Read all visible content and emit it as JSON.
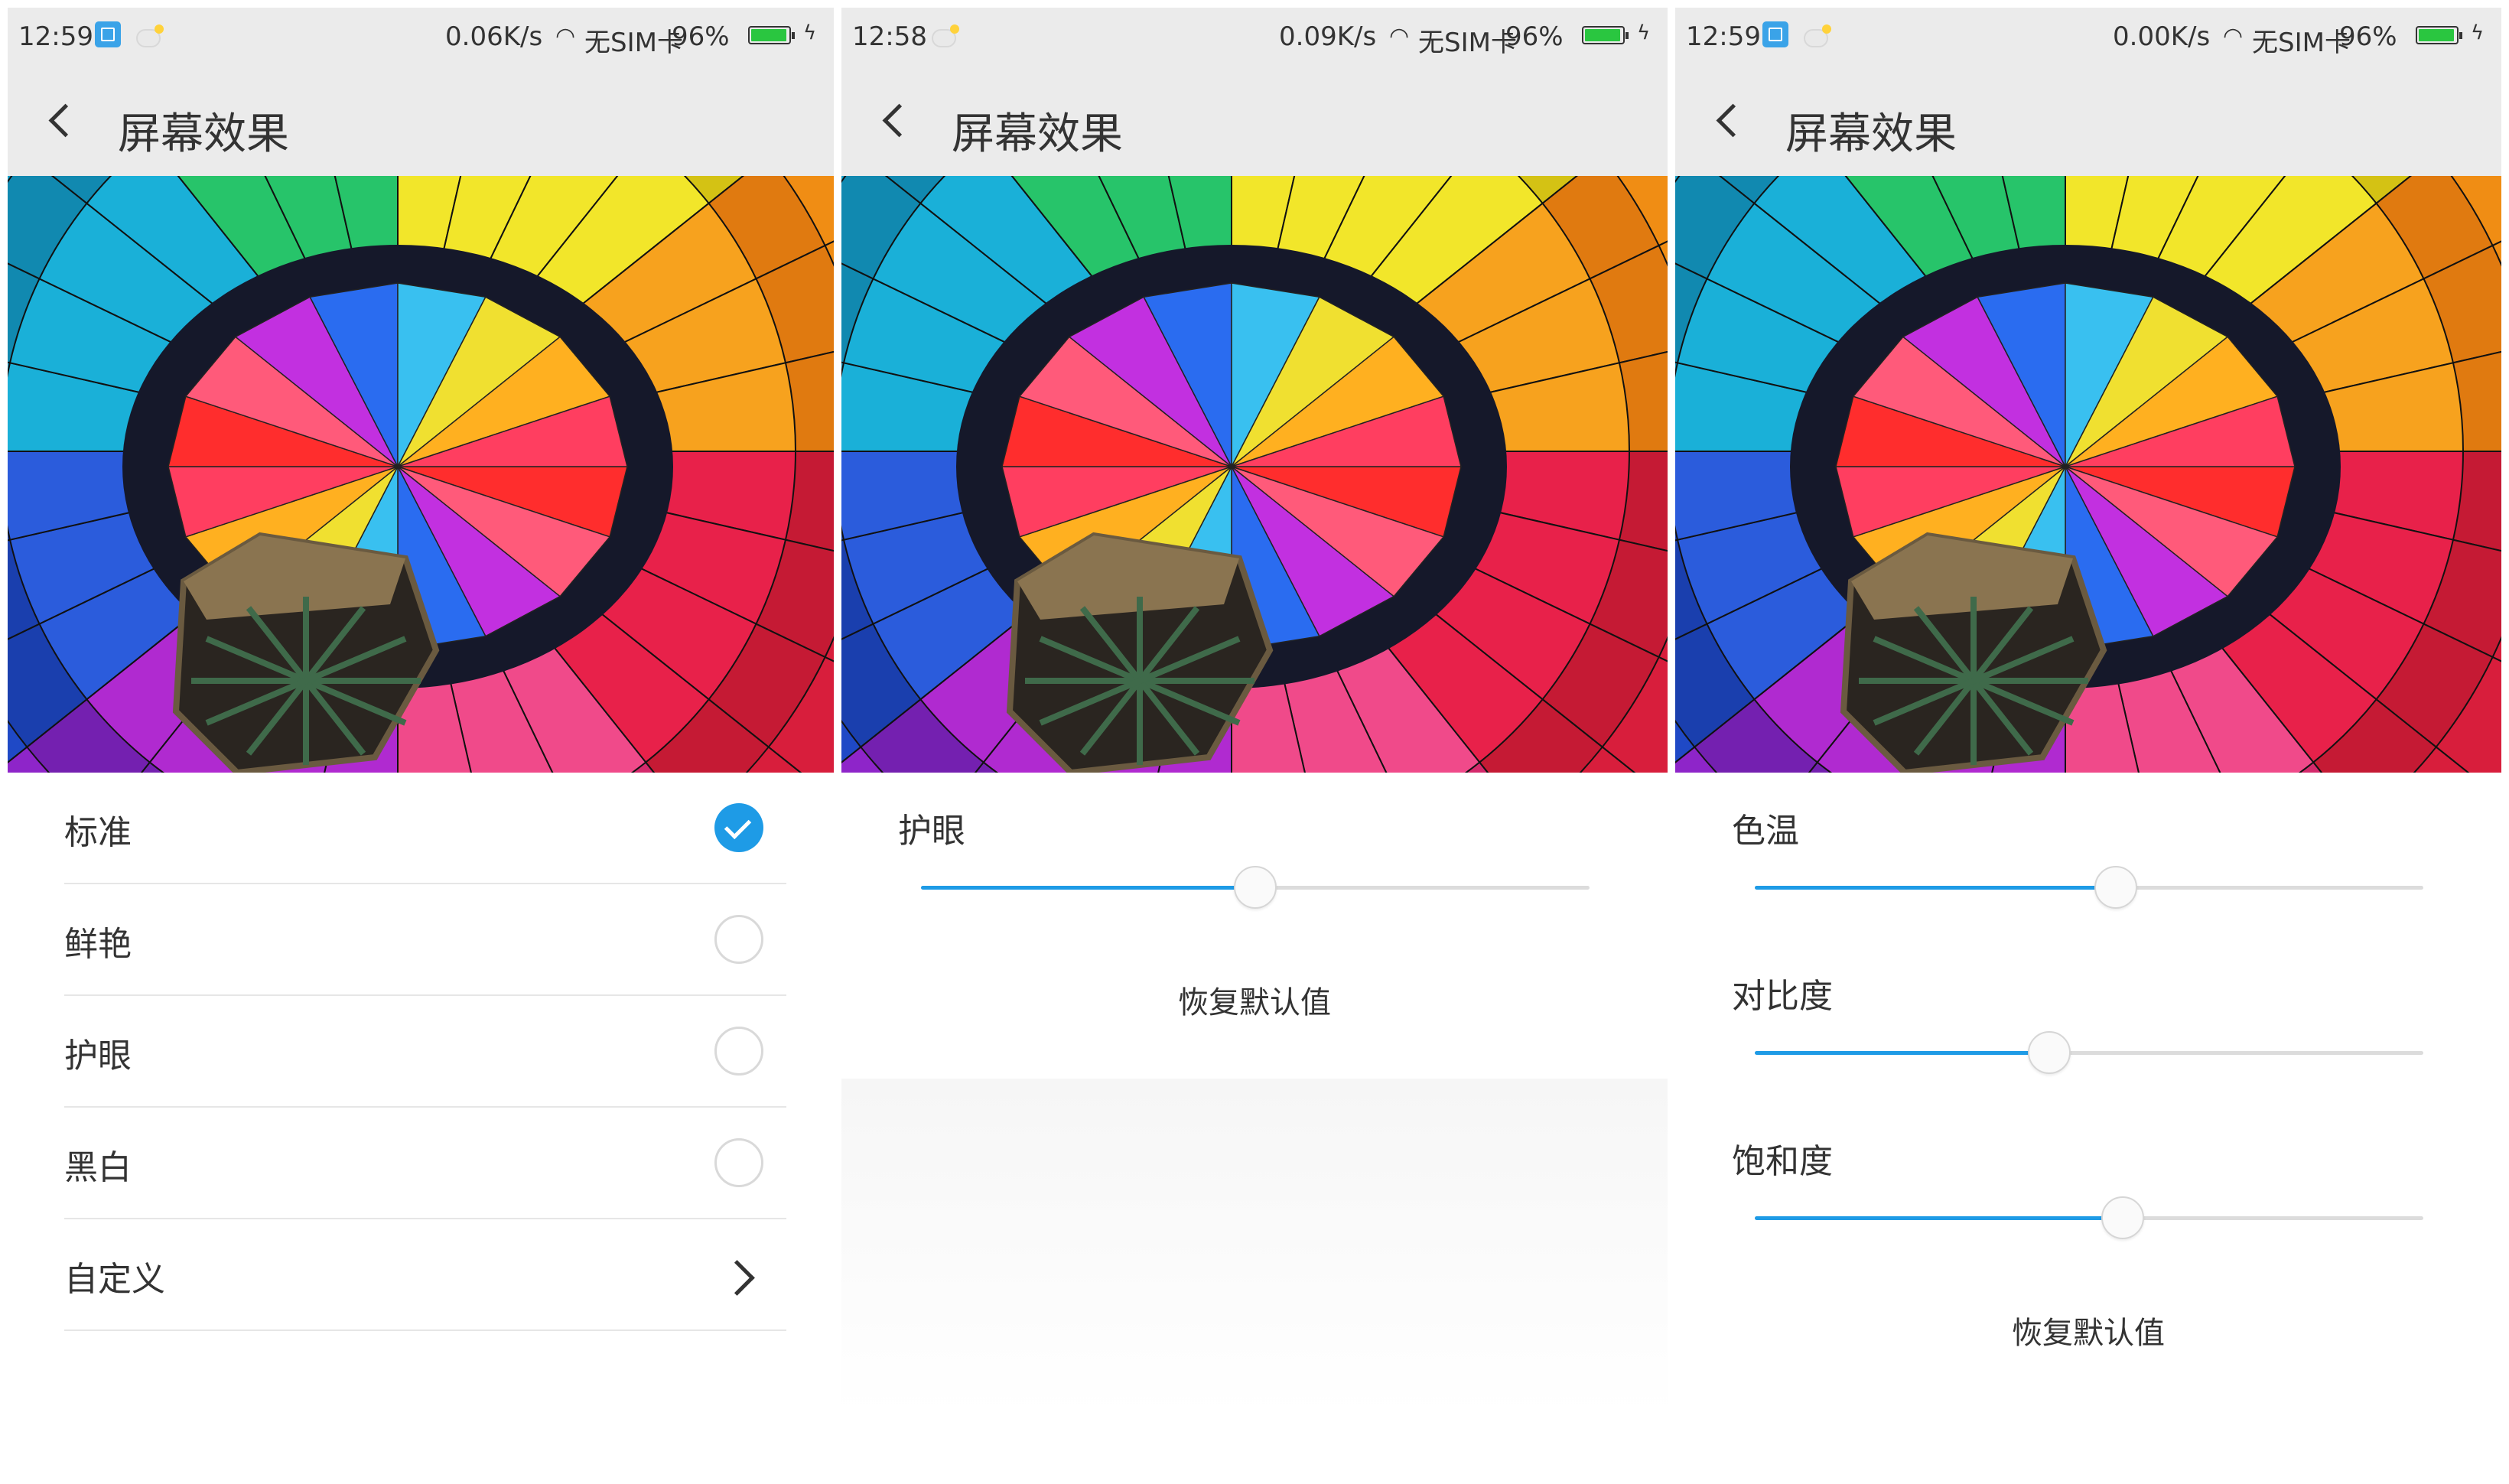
{
  "screens": [
    {
      "status": {
        "time": "12:59",
        "speed": "0.06K/s",
        "sim": "无SIM卡",
        "battery": "96%",
        "battery_level": 0.96,
        "has_screenshot_icon": true
      },
      "header": {
        "title": "屏幕效果"
      },
      "options": [
        {
          "label": "标准",
          "state": "selected"
        },
        {
          "label": "鲜艳",
          "state": "unselected"
        },
        {
          "label": "护眼",
          "state": "unselected"
        },
        {
          "label": "黑白",
          "state": "unselected"
        },
        {
          "label": "自定义",
          "state": "chevron"
        }
      ]
    },
    {
      "status": {
        "time": "12:58",
        "speed": "0.09K/s",
        "sim": "无SIM卡",
        "battery": "96%",
        "battery_level": 0.96,
        "has_screenshot_icon": false
      },
      "header": {
        "title": "屏幕效果"
      },
      "sliders": [
        {
          "label": "护眼",
          "value": 0.5
        }
      ],
      "reset_label": "恢复默认值"
    },
    {
      "status": {
        "time": "12:59",
        "speed": "0.00K/s",
        "sim": "无SIM卡",
        "battery": "96%",
        "battery_level": 0.96,
        "has_screenshot_icon": true
      },
      "header": {
        "title": "屏幕效果"
      },
      "sliders": [
        {
          "label": "色温",
          "value": 0.54
        },
        {
          "label": "对比度",
          "value": 0.44
        },
        {
          "label": "饱和度",
          "value": 0.55
        }
      ],
      "reset_label": "恢复默认值"
    }
  ],
  "colors": {
    "accent": "#1e9be6",
    "header_bg": "#ebebeb",
    "divider": "#e6e6e6",
    "track": "#dcdcdc",
    "battery": "#2ac640"
  },
  "icons": {
    "back": "back-arrow-icon",
    "check": "check-icon",
    "chevron": "chevron-right-icon",
    "wifi": "wifi-icon",
    "battery": "battery-icon",
    "screenshot": "screenshot-icon",
    "weather": "weather-icon"
  }
}
